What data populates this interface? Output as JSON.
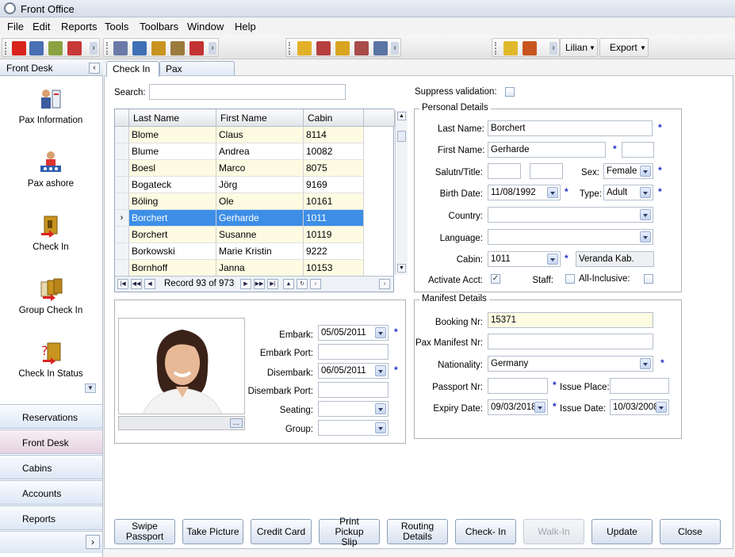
{
  "window": {
    "title": "Front Office"
  },
  "menu": [
    "File",
    "Edit",
    "Reports",
    "Tools",
    "Toolbars",
    "Window",
    "Help"
  ],
  "toolbar": {
    "user": "Lilian",
    "export": "Export"
  },
  "leftpane": {
    "header": "Front Desk",
    "items": [
      {
        "label": "Pax Information",
        "icon": "pax-information-icon"
      },
      {
        "label": "Pax ashore",
        "icon": "pax-ashore-icon"
      },
      {
        "label": "Check In",
        "icon": "check-in-icon"
      },
      {
        "label": "Group Check In",
        "icon": "group-check-in-icon"
      },
      {
        "label": "Check In Status",
        "icon": "check-in-status-icon"
      }
    ],
    "sections": [
      "Reservations",
      "Front Desk",
      "Cabins",
      "Accounts",
      "Reports"
    ],
    "active_section": "Front Desk"
  },
  "tabs": [
    "Check In",
    "Pax Information"
  ],
  "search": {
    "label": "Search:",
    "value": ""
  },
  "suppress": {
    "label": "Suppress validation:"
  },
  "grid": {
    "columns": [
      "Last Name",
      "First Name",
      "Cabin"
    ],
    "rows": [
      [
        "Blome",
        "Claus",
        "8114"
      ],
      [
        "Blume",
        "Andrea",
        "10082"
      ],
      [
        "Boesl",
        "Marco",
        "8075"
      ],
      [
        "Bogateck",
        "Jörg",
        "9169"
      ],
      [
        "Böling",
        "Ole",
        "10161"
      ],
      [
        "Borchert",
        "Gerharde",
        "1011"
      ],
      [
        "Borchert",
        "Susanne",
        "10119"
      ],
      [
        "Borkowski",
        "Marie Kristin",
        "9222"
      ],
      [
        "Bornhoff",
        "Janna",
        "10153"
      ]
    ],
    "selected_index": 5,
    "record_text": "Record 93 of 973"
  },
  "personal": {
    "title": "Personal Details",
    "last_name_label": "Last Name:",
    "last_name": "Borchert",
    "first_name_label": "First Name:",
    "first_name": "Gerharde",
    "salutn_label": "Salutn/Title:",
    "sex_label": "Sex:",
    "sex": "Female",
    "birth_label": "Birth Date:",
    "birth": "11/08/1992",
    "type_label": "Type:",
    "type": "Adult",
    "country_label": "Country:",
    "country": "",
    "language_label": "Language:",
    "language": "",
    "cabin_label": "Cabin:",
    "cabin": "1011",
    "cabin_desc": "Veranda Kab.",
    "activate_label": "Activate Acct:",
    "activate_checked": true,
    "staff_label": "Staff:",
    "allinc_label": "All-Inclusive:"
  },
  "embark": {
    "embark_label": "Embark:",
    "embark": "05/05/2011",
    "embark_port_label": "Embark Port:",
    "disembark_label": "Disembark:",
    "disembark": "06/05/2011",
    "disembark_port_label": "Disembark Port:",
    "seating_label": "Seating:",
    "group_label": "Group:"
  },
  "manifest": {
    "title": "Manifest Details",
    "booking_label": "Booking Nr:",
    "booking": "15371",
    "pax_manifest_label": "Pax Manifest Nr:",
    "nationality_label": "Nationality:",
    "nationality": "Germany",
    "passport_label": "Passport Nr:",
    "issue_place_label": "Issue Place:",
    "expiry_label": "Expiry Date:",
    "expiry": "09/03/2018",
    "issue_date_label": "Issue Date:",
    "issue_date": "10/03/2008"
  },
  "buttons": {
    "swipe": "Swipe Passport",
    "picture": "Take Picture",
    "credit": "Credit Card",
    "print": "Print Pickup Slip",
    "routing": "Routing Details",
    "checkin": "Check- In",
    "walkin": "Walk-In",
    "update": "Update",
    "close": "Close"
  },
  "colors": {
    "row_selected": "#3d8ee6",
    "row_alt": "#fdfbe2",
    "accent": "#2230c8"
  }
}
